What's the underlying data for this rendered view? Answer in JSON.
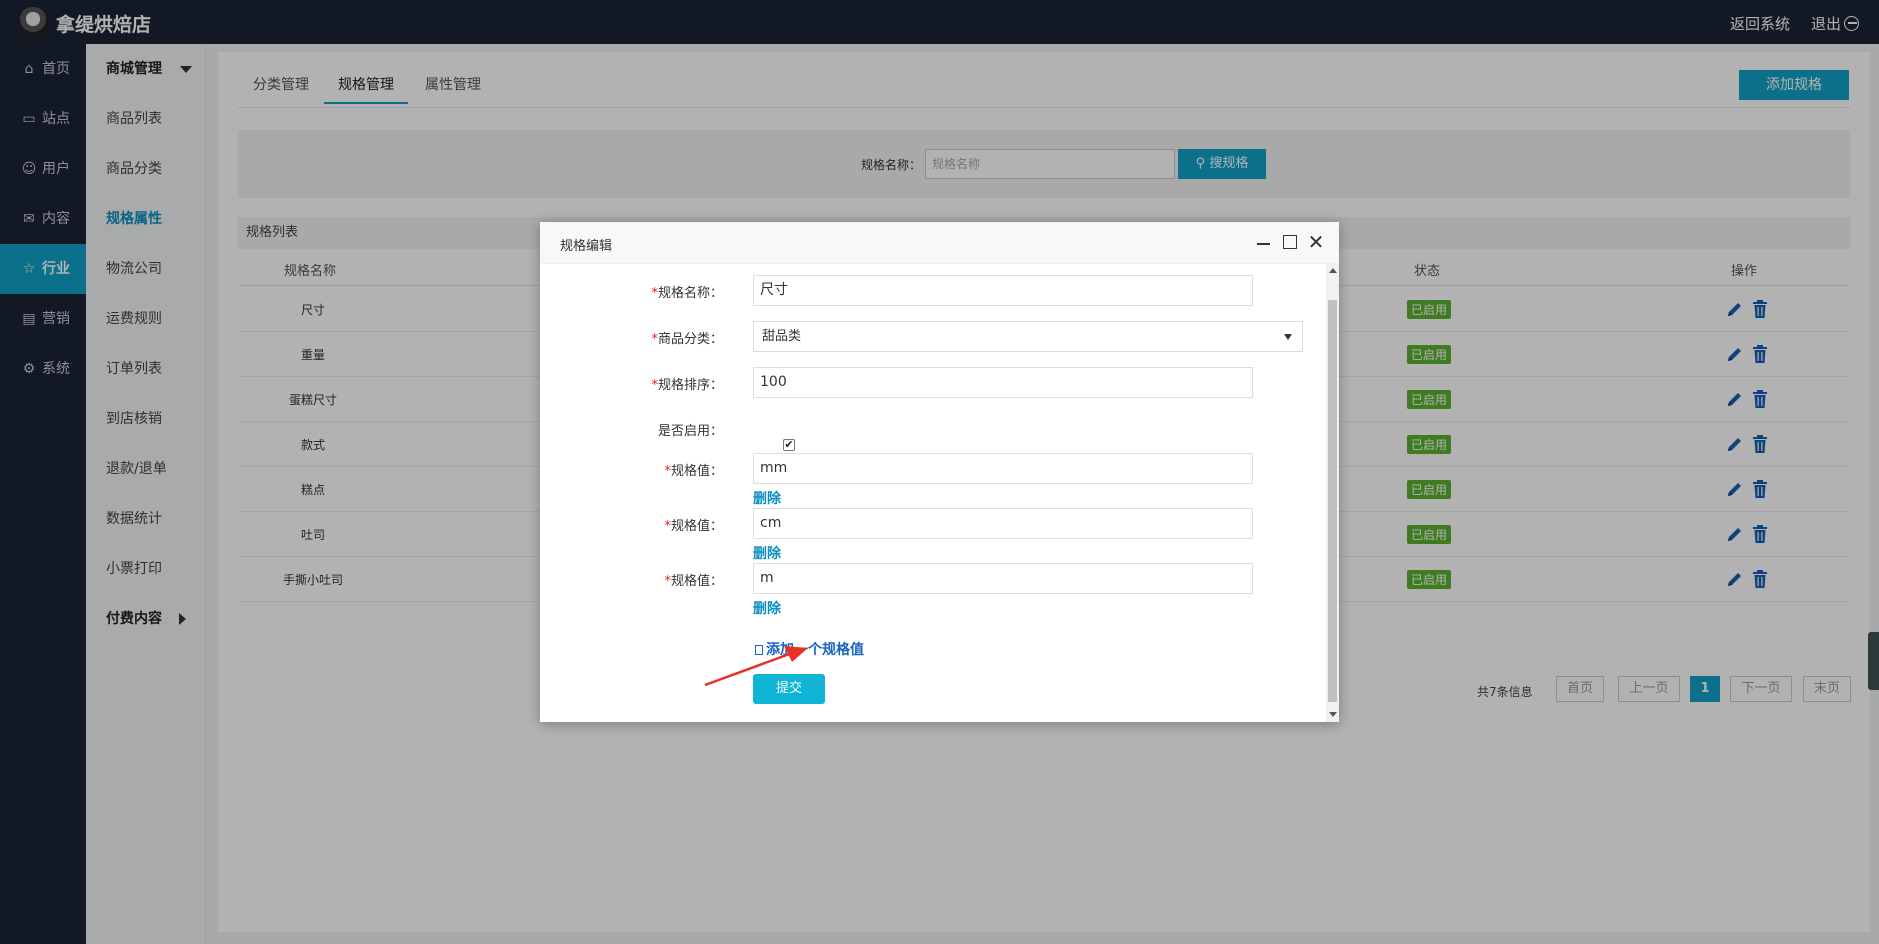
{
  "brand": {
    "name": "拿缇烘焙店"
  },
  "top": {
    "back": "返回系统",
    "logout": "退出"
  },
  "nav1": [
    {
      "label": "首页",
      "icon": "⌂"
    },
    {
      "label": "站点",
      "icon": "▭"
    },
    {
      "label": "用户",
      "icon": "☺"
    },
    {
      "label": "内容",
      "icon": "✉"
    },
    {
      "label": "行业",
      "icon": "☆"
    },
    {
      "label": "营销",
      "icon": "▤"
    },
    {
      "label": "系统",
      "icon": "⚙"
    }
  ],
  "nav2": [
    "商城管理",
    "商品列表",
    "商品分类",
    "规格属性",
    "物流公司",
    "运费规则",
    "订单列表",
    "到店核销",
    "退款/退单",
    "数据统计",
    "小票打印",
    "付费内容"
  ],
  "tabs": [
    "分类管理",
    "规格管理",
    "属性管理"
  ],
  "add_button": "添加规格",
  "search": {
    "label": "规格名称：",
    "placeholder": "规格名称",
    "button": "搜规格"
  },
  "list": {
    "title": "规格列表",
    "headers": {
      "name": "规格名称",
      "status": "状态",
      "ops": "操作"
    },
    "rows": [
      {
        "name": "尺寸",
        "status": "已启用"
      },
      {
        "name": "重量",
        "status": "已启用"
      },
      {
        "name": "蛋糕尺寸",
        "status": "已启用"
      },
      {
        "name": "款式",
        "status": "已启用"
      },
      {
        "name": "糕点",
        "status": "已启用"
      },
      {
        "name": "吐司",
        "status": "已启用"
      },
      {
        "name": "手撕小吐司",
        "status": "已启用"
      }
    ]
  },
  "pager": {
    "info": "共7条信息",
    "first": "首页",
    "prev": "上一页",
    "current": "1",
    "next": "下一页",
    "last": "末页"
  },
  "modal": {
    "title": "规格编辑",
    "close": "✕",
    "fields": {
      "name_label": "规格名称：",
      "name_value": "尺寸",
      "category_label": "商品分类：",
      "category_value": "甜品类",
      "sort_label": "规格排序：",
      "sort_value": "100",
      "enabled_label": "是否启用：",
      "enabled_mark": "✔"
    },
    "spec_label": "规格值：",
    "spec_values": [
      "mm",
      "cm",
      "m"
    ],
    "delete": "删除",
    "add_value": "添加一个规格值",
    "submit": "提交"
  },
  "colors": {
    "accent": "#10a3c6",
    "nav_bg": "#1b2436",
    "status_green": "#59b030",
    "required": "#e02020"
  }
}
